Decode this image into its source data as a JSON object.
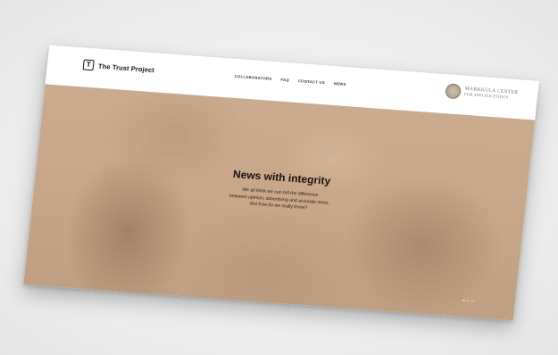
{
  "brand": {
    "logo_mark": "T",
    "name": "The Trust Project"
  },
  "nav": {
    "items": [
      {
        "label": "COLLABORATORS"
      },
      {
        "label": "FAQ"
      },
      {
        "label": "CONTACT US"
      },
      {
        "label": "NEWS"
      }
    ]
  },
  "partner": {
    "line1": "MARKKULA CENTER",
    "line2": "FOR APPLIED ETHICS",
    "icon": "seal-icon"
  },
  "hero": {
    "title": "News with integrity",
    "subtitle_lines": [
      "We all think we can tell the difference",
      "between opinion, advertising and accurate news.",
      "But how do we really know?"
    ]
  },
  "colors": {
    "hero_tint": "#c9aa8c",
    "page_bg": "#efefef",
    "text_dark": "#1a120c"
  }
}
